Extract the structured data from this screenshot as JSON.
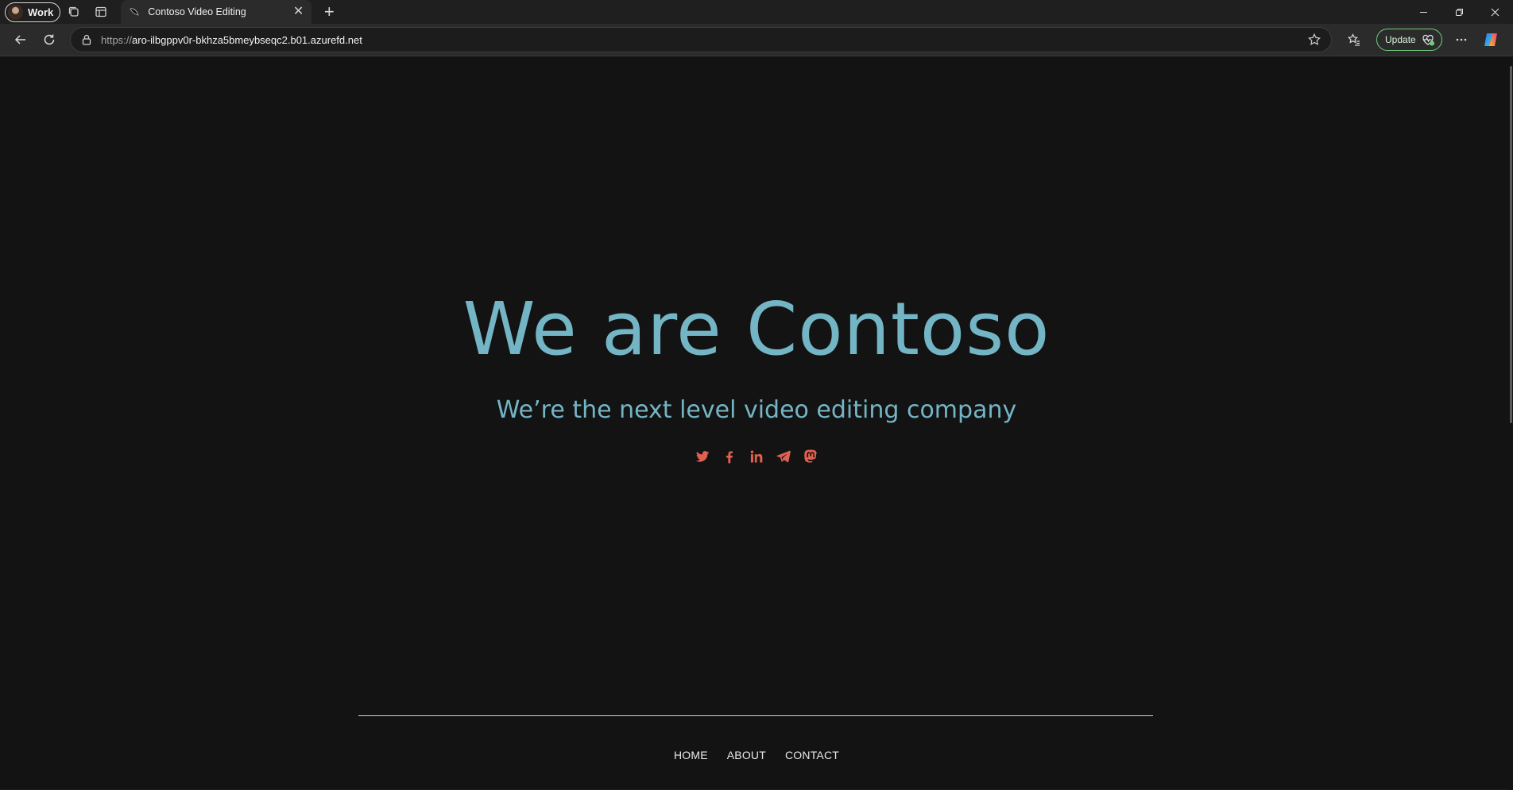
{
  "browser": {
    "profile_label": "Work",
    "tab": {
      "title": "Contoso Video Editing"
    },
    "address": {
      "scheme": "https://",
      "host": "aro-ilbgppv0r-bkhza5bmeybseqc2.b01.azurefd.net"
    },
    "update_label": "Update"
  },
  "hero": {
    "title": "We are Contoso",
    "subtitle": "We’re the next level video editing company"
  },
  "socials": [
    {
      "name": "twitter-icon"
    },
    {
      "name": "facebook-icon"
    },
    {
      "name": "linkedin-icon"
    },
    {
      "name": "telegram-icon"
    },
    {
      "name": "mastodon-icon"
    }
  ],
  "footer": {
    "nav": [
      {
        "label": "HOME"
      },
      {
        "label": "ABOUT"
      },
      {
        "label": "CONTACT"
      }
    ]
  },
  "colors": {
    "accent_text": "#74b5c5",
    "social_icons": "#e2604f",
    "page_background": "#131313"
  }
}
